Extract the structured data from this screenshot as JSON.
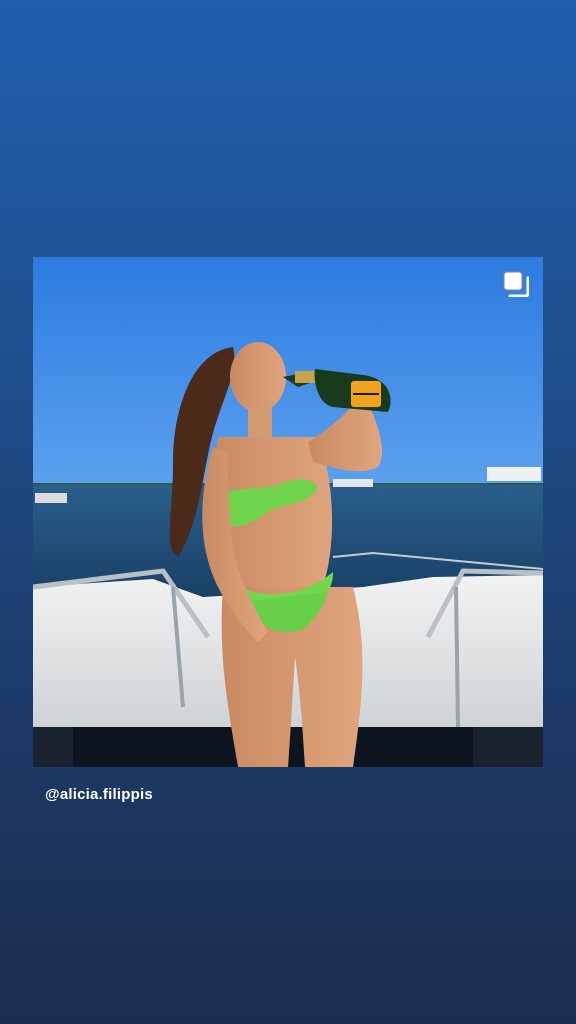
{
  "story": {
    "username": "@alicia.filippis",
    "post": {
      "photo_icon": "person-on-boat-with-bottle",
      "overlay_icon": "multiple-photos-icon"
    }
  },
  "colors": {
    "background_top": "#1f5fae",
    "background_bottom": "#1b2d4c",
    "sky": "#2f7fe0",
    "sea": "#1d4f79",
    "boat": "#e8e8e8",
    "bikini": "#6fd34c",
    "bottle_label": "#f3a21b"
  }
}
